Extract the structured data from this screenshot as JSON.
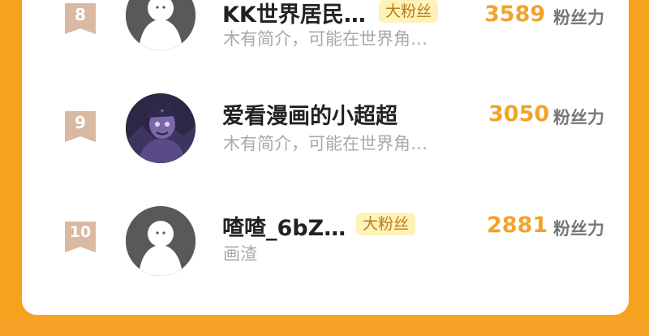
{
  "ranking": {
    "count_label": "粉丝力",
    "rows": [
      {
        "rank": "8",
        "name": "KK世界居民…",
        "badge": "大粉丝",
        "description": "木有简介，可能在世界角…",
        "count": "3589"
      },
      {
        "rank": "9",
        "name": "爱看漫画的小超超",
        "description": "木有简介，可能在世界角…",
        "count": "3050"
      },
      {
        "rank": "10",
        "name": "喳喳_6bZ…",
        "badge": "大粉丝",
        "description": "画渣",
        "count": "2881"
      }
    ]
  },
  "colors": {
    "background": "#f7a21d",
    "card": "#ffffff",
    "count": "#f2a32a",
    "badge_bg": "#fff2b8",
    "rank_badge": "#d9b9a1"
  }
}
